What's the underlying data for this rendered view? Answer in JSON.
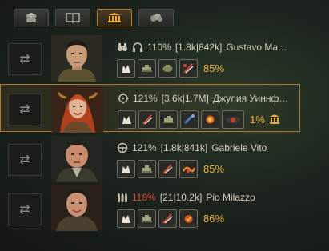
{
  "tabs": [
    {
      "icon": "crew-group-icon"
    },
    {
      "icon": "book-icon"
    },
    {
      "icon": "bank-icon",
      "active": true
    },
    {
      "icon": "coins-icon"
    }
  ],
  "crew": [
    {
      "role_icons": [
        "binoculars-icon",
        "headphones-icon"
      ],
      "efficiency": "110%",
      "stats": "[1.8k|842k]",
      "name": "Gustavo Ma…",
      "perks": [
        "brothers-in-arms-perk",
        "repair-perk",
        "camouflage-perk",
        "sixth-sense-perk"
      ],
      "skill_percent": "85%"
    },
    {
      "role_icons": [
        "gun-sight-icon"
      ],
      "efficiency": "121%",
      "stats": "[3.6k|1.7M]",
      "name": "Джулия Уиннф…",
      "perks": [
        "brothers-in-arms-perk",
        "sixth-sense-perk",
        "repair-perk",
        "firefighting-perk",
        "snap-shot-perk",
        "deadeye-perk"
      ],
      "skill_percent": "1%",
      "extra_icon": "bank-icon"
    },
    {
      "role_icons": [
        "steering-wheel-icon"
      ],
      "efficiency": "121%",
      "stats": "[1.8k|841k]",
      "name": "Gabriele Vito",
      "perks": [
        "brothers-in-arms-perk",
        "repair-perk",
        "sixth-sense-perk",
        "smooth-ride-perk"
      ],
      "skill_percent": "85%"
    },
    {
      "role_icons": [
        "shells-icon"
      ],
      "efficiency": "118%",
      "efficiency_low": true,
      "stats": "[21|10.2k]",
      "name": "Pio Milazzo",
      "perks": [
        "brothers-in-arms-perk",
        "repair-perk",
        "sixth-sense-perk",
        "safe-stowage-perk"
      ],
      "skill_percent": "86%"
    }
  ],
  "colors": {
    "accent": "#f0b23c",
    "red": "#e0433a",
    "border_active": "#b07a2a"
  }
}
